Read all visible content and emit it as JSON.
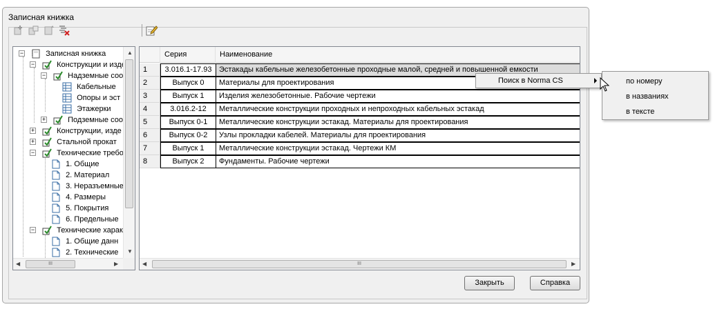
{
  "window": {
    "title": "Записная книжка"
  },
  "toolbar": {
    "icons": [
      "add-item-icon",
      "add-subitem-icon",
      "move-item-icon",
      "delete-items-icon",
      "edit-note-icon"
    ]
  },
  "tree": {
    "items": [
      {
        "label": "Записная книжка",
        "icon": "notebook-icon"
      },
      {
        "label": "Конструкции и изде",
        "icon": "checked-folder-icon"
      },
      {
        "label": "Надземные соор",
        "icon": "checked-folder-icon"
      },
      {
        "label": "Кабельные",
        "icon": "table-doc-icon"
      },
      {
        "label": "Опоры и эст",
        "icon": "table-doc-icon"
      },
      {
        "label": "Этажерки",
        "icon": "table-doc-icon"
      },
      {
        "label": "Подземные соор",
        "icon": "checked-folder-icon"
      },
      {
        "label": "Конструкции, изде",
        "icon": "checked-folder-icon"
      },
      {
        "label": "Стальной прокат",
        "icon": "checked-folder-icon"
      },
      {
        "label": "Технические требо",
        "icon": "checked-folder-icon"
      },
      {
        "label": "1. Общие",
        "icon": "document-icon"
      },
      {
        "label": "2. Материал",
        "icon": "document-icon"
      },
      {
        "label": "3. Неразъемные",
        "icon": "document-icon"
      },
      {
        "label": "4. Размеры",
        "icon": "document-icon"
      },
      {
        "label": "5. Покрытия",
        "icon": "document-icon"
      },
      {
        "label": "6. Предельные",
        "icon": "document-icon"
      },
      {
        "label": "Технические харак",
        "icon": "checked-folder-icon"
      },
      {
        "label": "1. Общие данн",
        "icon": "document-icon"
      },
      {
        "label": "2. Технические",
        "icon": "document-icon"
      }
    ]
  },
  "grid": {
    "columns": [
      "Серия",
      "Наименование"
    ],
    "rows": [
      {
        "num": "1",
        "series": "3.016.1-17.93",
        "name": "Эстакады кабельные железобетонные проходные малой, средней и повышенной емкости"
      },
      {
        "num": "2",
        "series": "Выпуск 0",
        "name": "Материалы для проектирования"
      },
      {
        "num": "3",
        "series": "Выпуск 1",
        "name": "Изделия железобетонные. Рабочие чертежи"
      },
      {
        "num": "4",
        "series": "3.016.2-12",
        "name": "Металлические конструкции проходных и непроходных кабельных эстакад"
      },
      {
        "num": "5",
        "series": "Выпуск 0-1",
        "name": "Металлические конструкции эстакад. Материалы для проектирования"
      },
      {
        "num": "6",
        "series": "Выпуск 0-2",
        "name": "Узлы прокладки кабелей. Материалы для проектирования"
      },
      {
        "num": "7",
        "series": "Выпуск 1",
        "name": "Металлические конструкции эстакад. Чертежи КМ"
      },
      {
        "num": "8",
        "series": "Выпуск 2",
        "name": "Фундаменты. Рабочие чертежи"
      }
    ]
  },
  "buttons": {
    "close": "Закрыть",
    "help": "Справка"
  },
  "context_menu": {
    "item": "Поиск в Norma CS",
    "submenu": [
      "по номеру",
      "в названиях",
      "в тексте"
    ]
  },
  "colors": {
    "check_green": "#2a8a2a",
    "doc_blue": "#3a6ea5"
  }
}
